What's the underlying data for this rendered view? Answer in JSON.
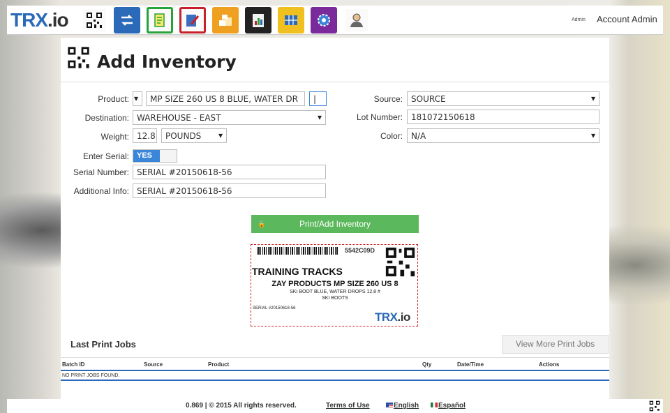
{
  "app": {
    "logo_text": "TRX",
    "logo_suffix": ".io",
    "account_small": "Admin",
    "account_name": "Account Admin"
  },
  "nav": [
    {
      "icon": "qr-code-icon",
      "color": "#ffffff"
    },
    {
      "icon": "transfer-arrows-icon",
      "color": "#2a6ab8"
    },
    {
      "icon": "document-icon",
      "color": "#27a33a"
    },
    {
      "icon": "edit-report-icon",
      "color": "#c8202a"
    },
    {
      "icon": "boxes-icon",
      "color": "#f0a020"
    },
    {
      "icon": "clipboard-chart-icon",
      "color": "#222222"
    },
    {
      "icon": "inventory-grid-icon",
      "color": "#f0c020"
    },
    {
      "icon": "settings-gear-icon",
      "color": "#7a2a9a"
    },
    {
      "icon": "user-account-icon",
      "color": "#ffffff"
    }
  ],
  "page": {
    "title": "Add Inventory"
  },
  "form": {
    "product_label": "Product:",
    "product_value": "MP SIZE 260 US 8 BLUE, WATER DR",
    "qty_value": "|",
    "destination_label": "Destination:",
    "destination_value": "WAREHOUSE - EAST",
    "weight_label": "Weight:",
    "weight_value": "12.8",
    "weight_unit": "POUNDS",
    "serial_toggle_label": "Enter Serial:",
    "serial_toggle_value": "YES",
    "serial_label": "Serial Number:",
    "serial_value": "SERIAL #20150618-56",
    "info_label": "Additional Info:",
    "info_value": "SERIAL #20150618-56",
    "source_label": "Source:",
    "source_value": "SOURCE",
    "lot_label": "Lot Number:",
    "lot_value": "181072150618",
    "color_label": "Color:",
    "color_value": "N/A"
  },
  "actions": {
    "print_button": "Print/Add Inventory"
  },
  "label_preview": {
    "code": "5542C09D",
    "brand": "TRAINING TRACKS",
    "product": "ZAY PRODUCTS MP SIZE 260 US 8",
    "desc_line1": "SKI BOOT BLUE, WATER DROPS 12.8 #",
    "desc_line2": "SKI BOOTS",
    "serial": "SERIAL #20150618-56",
    "logo": "TRX",
    "logo_suffix": ".io"
  },
  "jobs": {
    "title": "Last Print Jobs",
    "more_button": "View More Print Jobs",
    "columns": [
      "Batch ID",
      "Source",
      "Product",
      "Qty",
      "Date/Time",
      "Actions"
    ],
    "empty_text": "NO PRINT JOBS FOUND."
  },
  "footer": {
    "copyright": "0.869 | © 2015 All rights reserved.",
    "terms": "Terms of Use",
    "english": "English",
    "spanish": "Español"
  },
  "colors": {
    "brand": "#2a6ab8",
    "success": "#5cb85c",
    "toggle_on": "#3a86d8"
  }
}
